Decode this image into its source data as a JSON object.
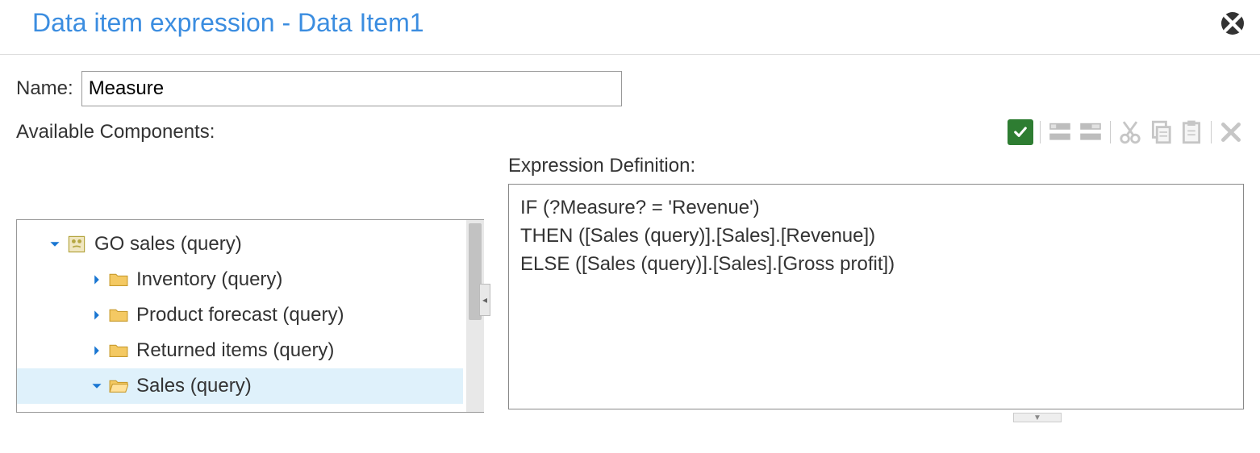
{
  "header": {
    "title": "Data item expression - Data Item1"
  },
  "name": {
    "label": "Name:",
    "value": "Measure"
  },
  "componentsLabel": "Available Components:",
  "expression": {
    "label": "Expression Definition:",
    "text": "IF (?Measure? = 'Revenue')\nTHEN ([Sales (query)].[Sales].[Revenue])\nELSE ([Sales (query)].[Sales].[Gross profit])"
  },
  "tree": {
    "root": {
      "label": "GO sales (query)",
      "expanded": true,
      "children": [
        {
          "label": "Inventory (query)",
          "expanded": false,
          "selected": false
        },
        {
          "label": "Product forecast (query)",
          "expanded": false,
          "selected": false
        },
        {
          "label": "Returned items (query)",
          "expanded": false,
          "selected": false
        },
        {
          "label": "Sales (query)",
          "expanded": true,
          "selected": true
        }
      ]
    }
  }
}
